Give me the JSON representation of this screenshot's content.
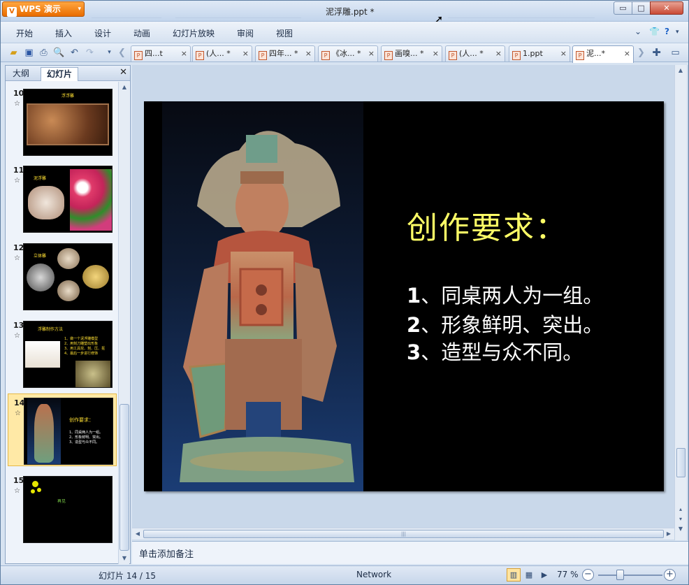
{
  "app": {
    "name": "WPS 演示",
    "logo_glyph": "V",
    "menu_caret": "▾"
  },
  "window": {
    "title": "泥浮雕.ppt *",
    "minimize": "▭",
    "maximize": "□",
    "close": "✕"
  },
  "menu": [
    "开始",
    "插入",
    "设计",
    "动画",
    "幻灯片放映",
    "审阅",
    "视图"
  ],
  "toolbar": {
    "icons": [
      "open-folder-icon",
      "save-icon",
      "print-icon",
      "print-preview-icon",
      "undo-icon",
      "redo-icon",
      "dropdown-icon",
      "tab-scroll-left-icon"
    ],
    "tabs": [
      {
        "label": "四...t",
        "active": false
      },
      {
        "label": "(人... *",
        "active": false
      },
      {
        "label": "四年... *",
        "active": false
      },
      {
        "label": "《冰... *",
        "active": false
      },
      {
        "label": "画嗅... *",
        "active": false
      },
      {
        "label": "(人... *",
        "active": false
      },
      {
        "label": "1.ppt",
        "active": false
      },
      {
        "label": "泥...*",
        "active": true
      }
    ],
    "tab_close": "×"
  },
  "left_pane": {
    "tabs": [
      "大纲",
      "幻灯片"
    ],
    "active_tab": "幻灯片",
    "close": "✕",
    "slides": [
      {
        "number": "10",
        "title": "浮浮雕"
      },
      {
        "number": "11",
        "title": "泥浮雕"
      },
      {
        "number": "12",
        "title": "立体雕"
      },
      {
        "number": "13",
        "title": "浮雕制作方法",
        "lines": [
          "1、做一个泥浮雕模型",
          "2、用刻刀雕塑出形象",
          "3、用工具挖、刻、压、抠",
          "4、最后一步进行修饰"
        ]
      },
      {
        "number": "14",
        "title": "创作要求：",
        "lines": [
          "1、同桌两人为一组。",
          "2、形象鲜明、突出。",
          "3、造型与众不同。"
        ]
      },
      {
        "number": "15",
        "title": "再见"
      }
    ],
    "selected_slide": "14",
    "star_glyph": "☆"
  },
  "slide": {
    "title": "创作要求：",
    "items": [
      {
        "num": "1",
        "text": "、同桌两人为一组。"
      },
      {
        "num": "2",
        "text": "、形象鲜明、突出。"
      },
      {
        "num": "3",
        "text": "、造型与众不同。"
      }
    ],
    "title_color": "#ffff66",
    "background": "#000000"
  },
  "notes": {
    "placeholder": "单击添加备注"
  },
  "status": {
    "slide_indicator": "幻灯片 14 / 15",
    "network": "Network",
    "zoom": "77 %",
    "zoom_fraction": 0.5
  },
  "colors": {
    "accent": "#e96c00",
    "selection": "#ffe9a6",
    "chrome": "#c9d8ea"
  }
}
